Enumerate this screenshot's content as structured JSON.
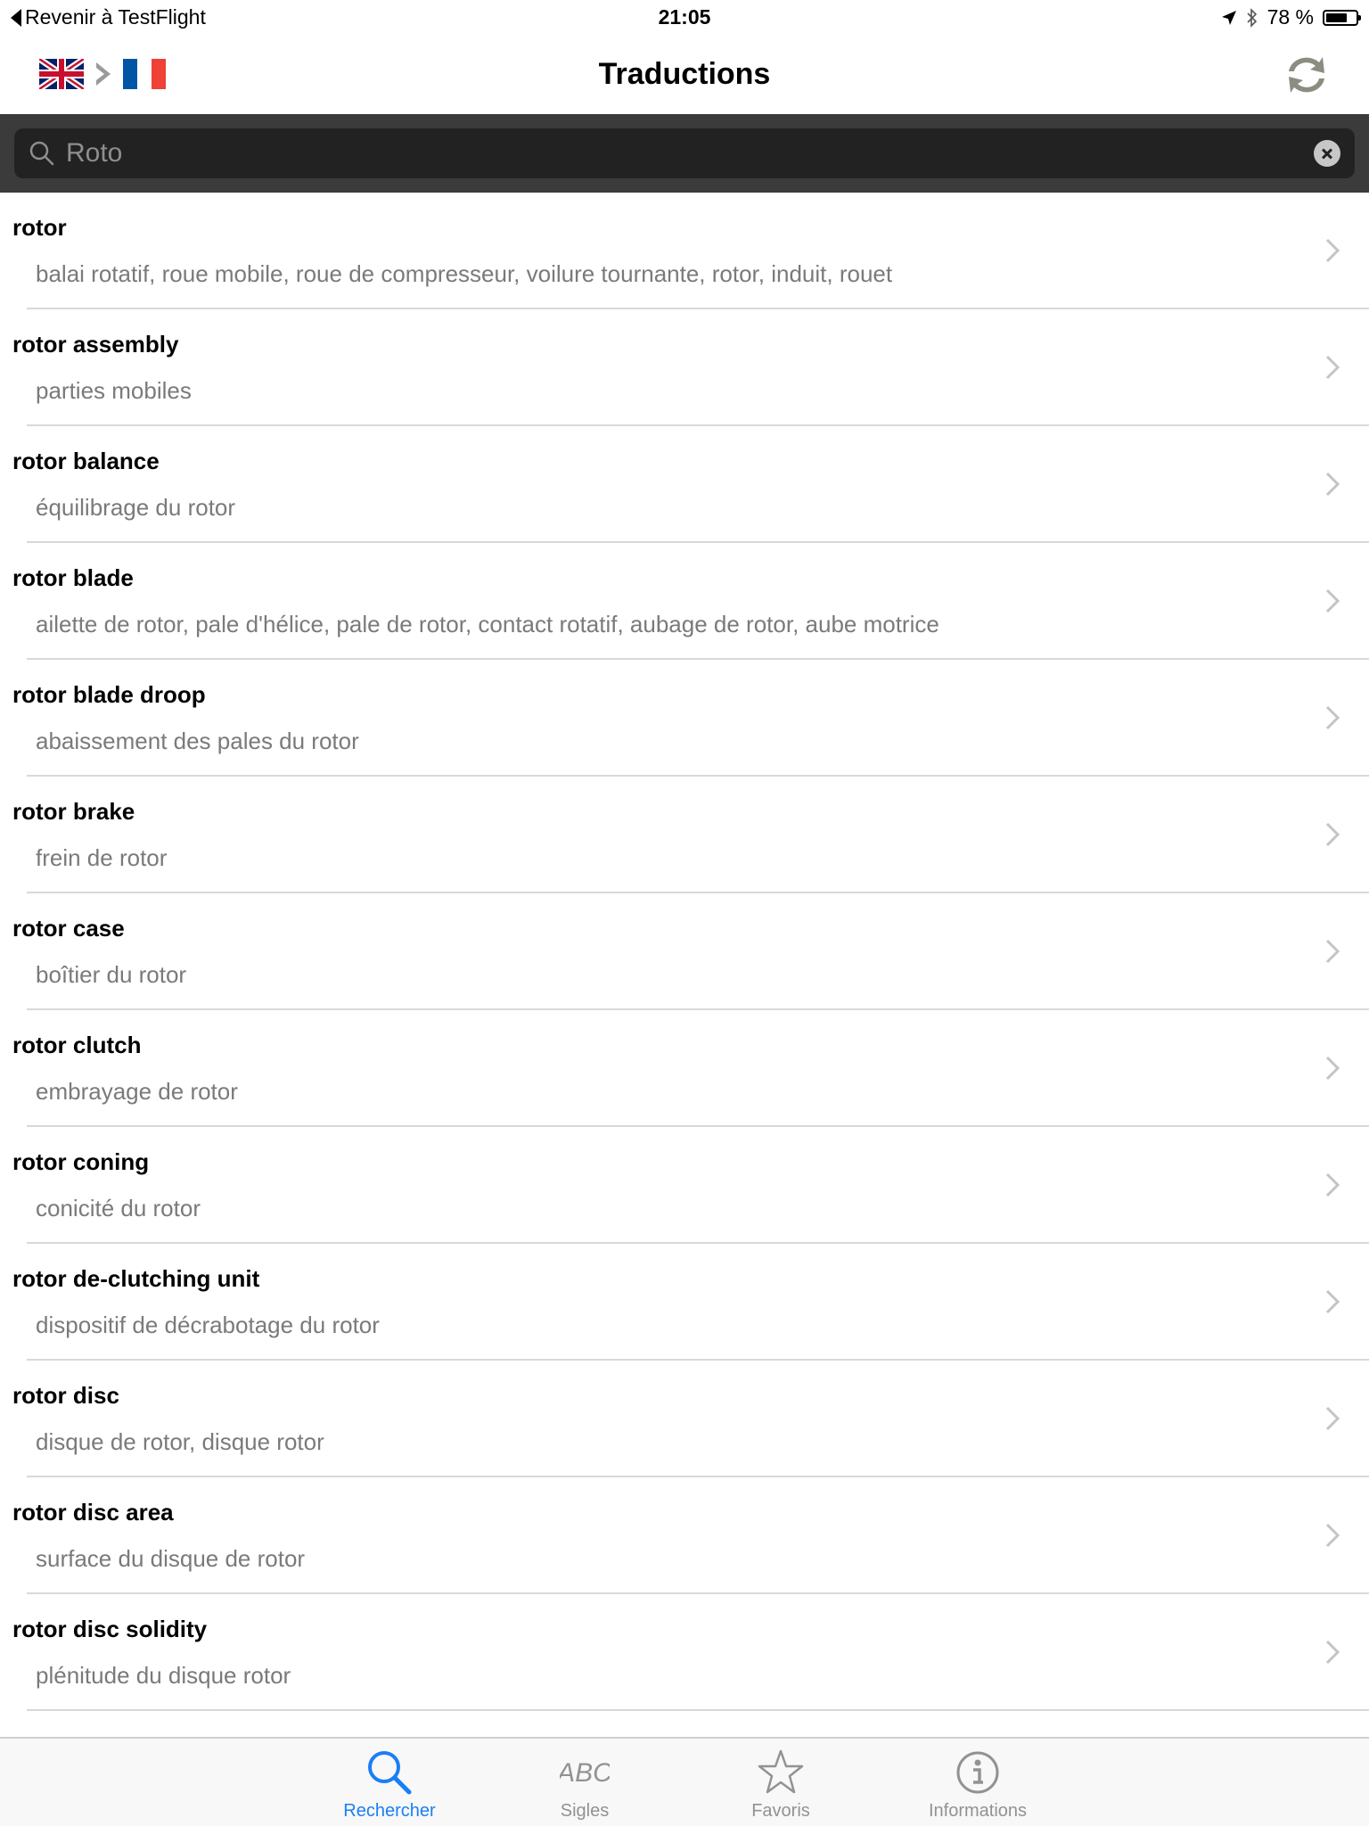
{
  "status_bar": {
    "back_label": "Revenir à TestFlight",
    "time": "21:05",
    "battery": "78 %",
    "battery_level": 0.78
  },
  "nav": {
    "title": "Traductions",
    "source_flag": "uk-flag-icon",
    "target_flag": "fr-flag-icon",
    "swap_icon": "swap-icon"
  },
  "search": {
    "value": "Roto"
  },
  "results": [
    {
      "term": "rotor",
      "translation": "balai rotatif, roue mobile, roue de compresseur, voilure tournante, rotor, induit, rouet"
    },
    {
      "term": "rotor assembly",
      "translation": "parties mobiles"
    },
    {
      "term": "rotor balance",
      "translation": "équilibrage du rotor"
    },
    {
      "term": "rotor blade",
      "translation": "ailette de rotor, pale d'hélice, pale de rotor, contact rotatif, aubage de rotor, aube motrice"
    },
    {
      "term": "rotor blade droop",
      "translation": "abaissement des pales du rotor"
    },
    {
      "term": "rotor brake",
      "translation": "frein de rotor"
    },
    {
      "term": "rotor case",
      "translation": "boîtier du rotor"
    },
    {
      "term": "rotor clutch",
      "translation": "embrayage de rotor"
    },
    {
      "term": "rotor coning",
      "translation": "conicité du rotor"
    },
    {
      "term": "rotor de-clutching unit",
      "translation": "dispositif de décrabotage du rotor"
    },
    {
      "term": "rotor disc",
      "translation": "disque de rotor, disque rotor"
    },
    {
      "term": "rotor disc area",
      "translation": "surface du disque de rotor"
    },
    {
      "term": "rotor disc solidity",
      "translation": "plénitude du disque rotor"
    }
  ],
  "tabs": [
    {
      "label": "Rechercher",
      "icon": "search-icon",
      "active": true
    },
    {
      "label": "Sigles",
      "icon": "abc-icon",
      "active": false
    },
    {
      "label": "Favoris",
      "icon": "star-icon",
      "active": false
    },
    {
      "label": "Informations",
      "icon": "info-icon",
      "active": false
    }
  ],
  "colors": {
    "accent": "#1a7ff5",
    "search_bg": "#3b3b3b",
    "search_field": "#222222",
    "secondary_text": "#7a7a7a"
  }
}
